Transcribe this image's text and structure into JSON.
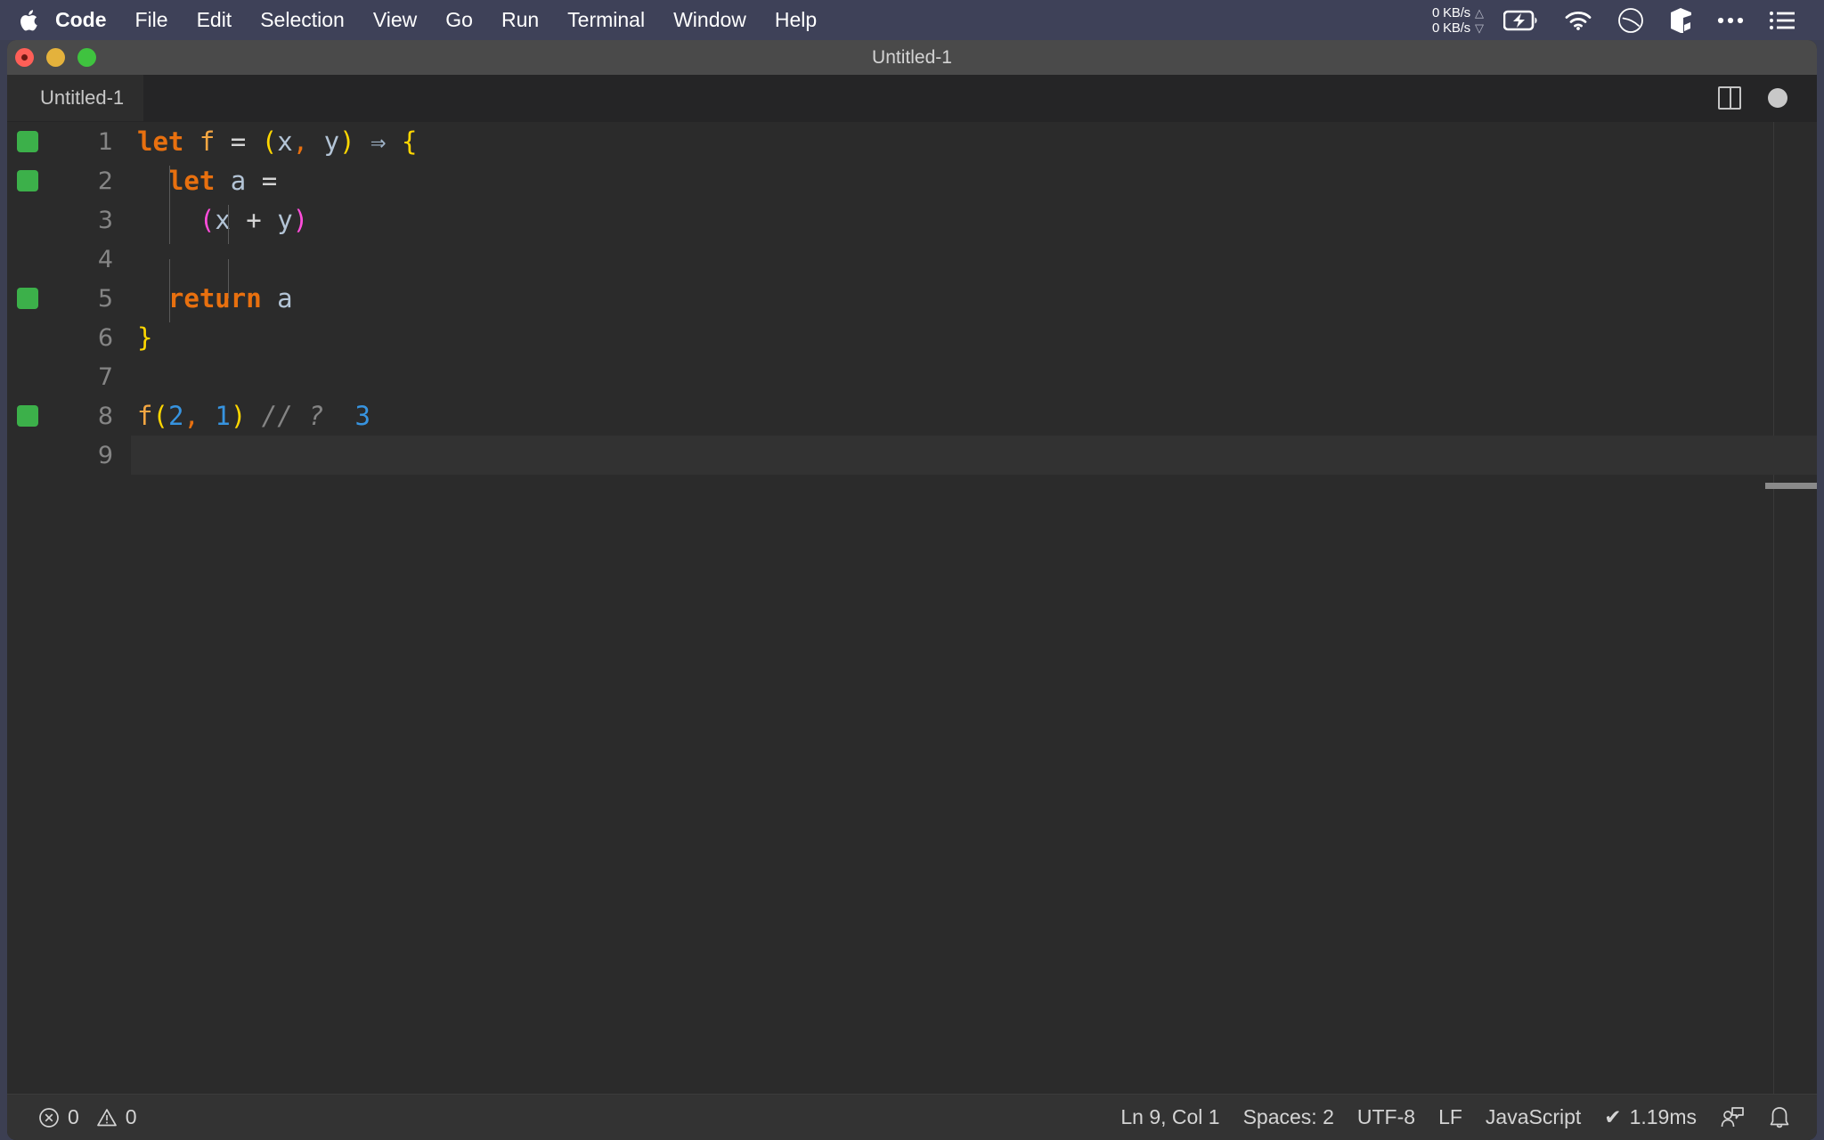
{
  "menubar": {
    "apple_icon": "apple-logo-icon",
    "items": [
      {
        "label": "Code",
        "bold": true
      },
      {
        "label": "File",
        "bold": false
      },
      {
        "label": "Edit",
        "bold": false
      },
      {
        "label": "Selection",
        "bold": false
      },
      {
        "label": "View",
        "bold": false
      },
      {
        "label": "Go",
        "bold": false
      },
      {
        "label": "Run",
        "bold": false
      },
      {
        "label": "Terminal",
        "bold": false
      },
      {
        "label": "Window",
        "bold": false
      },
      {
        "label": "Help",
        "bold": false
      }
    ],
    "network": {
      "upload": "0 KB/s",
      "download": "0 KB/s",
      "up_arrow": "△",
      "down_arrow": "▽"
    },
    "status_icons": [
      "battery-charging-icon",
      "wifi-icon",
      "do-not-disturb-icon",
      "cube-icon",
      "ellipsis-icon",
      "list-menu-icon"
    ]
  },
  "window": {
    "title": "Untitled-1",
    "traffic_lights": [
      "close-button",
      "minimize-button",
      "maximize-button"
    ]
  },
  "tabs": [
    {
      "label": "Untitled-1",
      "active": true,
      "dirty": true
    }
  ],
  "editor_actions": {
    "split_label": "split-editor",
    "dirty_label": "unsaved-changes"
  },
  "editor": {
    "lines": [
      {
        "number": "1",
        "marker": true,
        "guides": [],
        "active": false,
        "tokens": [
          {
            "t": "let",
            "c": "t-keyword"
          },
          {
            "t": " ",
            "c": "t-op"
          },
          {
            "t": "f",
            "c": "t-func"
          },
          {
            "t": " ",
            "c": "t-op"
          },
          {
            "t": "=",
            "c": "t-op"
          },
          {
            "t": " ",
            "c": "t-op"
          },
          {
            "t": "(",
            "c": "t-paren-y"
          },
          {
            "t": "x",
            "c": "t-var"
          },
          {
            "t": ",",
            "c": "t-comma"
          },
          {
            "t": " ",
            "c": "t-op"
          },
          {
            "t": "y",
            "c": "t-var"
          },
          {
            "t": ")",
            "c": "t-paren-y"
          },
          {
            "t": " ",
            "c": "t-op"
          },
          {
            "t": "⇒",
            "c": "t-arrow"
          },
          {
            "t": " ",
            "c": "t-op"
          },
          {
            "t": "{",
            "c": "t-paren-y"
          }
        ]
      },
      {
        "number": "2",
        "marker": true,
        "guides": [
          "g1"
        ],
        "active": false,
        "tokens": [
          {
            "t": "  ",
            "c": "t-op"
          },
          {
            "t": "let",
            "c": "t-keyword"
          },
          {
            "t": " ",
            "c": "t-op"
          },
          {
            "t": "a",
            "c": "t-var"
          },
          {
            "t": " ",
            "c": "t-op"
          },
          {
            "t": "=",
            "c": "t-op"
          }
        ]
      },
      {
        "number": "3",
        "marker": false,
        "guides": [
          "g1",
          "g2"
        ],
        "active": false,
        "tokens": [
          {
            "t": "    ",
            "c": "t-op"
          },
          {
            "t": "(",
            "c": "t-paren-m"
          },
          {
            "t": "x",
            "c": "t-var"
          },
          {
            "t": " ",
            "c": "t-op"
          },
          {
            "t": "+",
            "c": "t-op"
          },
          {
            "t": " ",
            "c": "t-op"
          },
          {
            "t": "y",
            "c": "t-var"
          },
          {
            "t": ")",
            "c": "t-paren-m"
          }
        ]
      },
      {
        "number": "4",
        "marker": false,
        "guides": [
          "g1",
          "g2"
        ],
        "active": false,
        "tokens": []
      },
      {
        "number": "5",
        "marker": true,
        "guides": [
          "g1"
        ],
        "active": false,
        "tokens": [
          {
            "t": "  ",
            "c": "t-op"
          },
          {
            "t": "return",
            "c": "t-keyword"
          },
          {
            "t": " ",
            "c": "t-op"
          },
          {
            "t": "a",
            "c": "t-var"
          }
        ]
      },
      {
        "number": "6",
        "marker": false,
        "guides": [],
        "active": false,
        "tokens": [
          {
            "t": "}",
            "c": "t-paren-y"
          }
        ]
      },
      {
        "number": "7",
        "marker": false,
        "guides": [],
        "active": false,
        "tokens": []
      },
      {
        "number": "8",
        "marker": true,
        "guides": [],
        "active": false,
        "tokens": [
          {
            "t": "f",
            "c": "t-func"
          },
          {
            "t": "(",
            "c": "t-paren-y"
          },
          {
            "t": "2",
            "c": "t-num"
          },
          {
            "t": ",",
            "c": "t-comma"
          },
          {
            "t": " ",
            "c": "t-op"
          },
          {
            "t": "1",
            "c": "t-num"
          },
          {
            "t": ")",
            "c": "t-paren-y"
          },
          {
            "t": " ",
            "c": "t-op"
          },
          {
            "t": "// ?",
            "c": "t-comment"
          },
          {
            "t": "  ",
            "c": "t-op"
          },
          {
            "t": "3",
            "c": "t-hint"
          }
        ]
      },
      {
        "number": "9",
        "marker": false,
        "guides": [],
        "active": true,
        "tokens": []
      }
    ]
  },
  "statusbar": {
    "errors": "0",
    "warnings": "0",
    "error_icon": "error-circle-icon",
    "warning_icon": "warning-triangle-icon",
    "position": "Ln 9, Col 1",
    "indentation": "Spaces: 2",
    "encoding": "UTF-8",
    "eol": "LF",
    "language": "JavaScript",
    "timing": "1.19ms",
    "timing_check": "✔",
    "feedback_icon": "feedback-person-icon",
    "bell_icon": "notifications-bell-icon"
  },
  "colors": {
    "menubar_bg": "#3e4158",
    "titlebar_bg": "#4a4a4a",
    "editor_bg": "#2b2b2b",
    "statusbar_bg": "#333333",
    "marker_green": "#3cb04a",
    "keyword_orange": "#e8700f",
    "number_blue": "#3794e0",
    "paren_yellow": "#ffd700",
    "paren_magenta": "#ff4ddb"
  }
}
